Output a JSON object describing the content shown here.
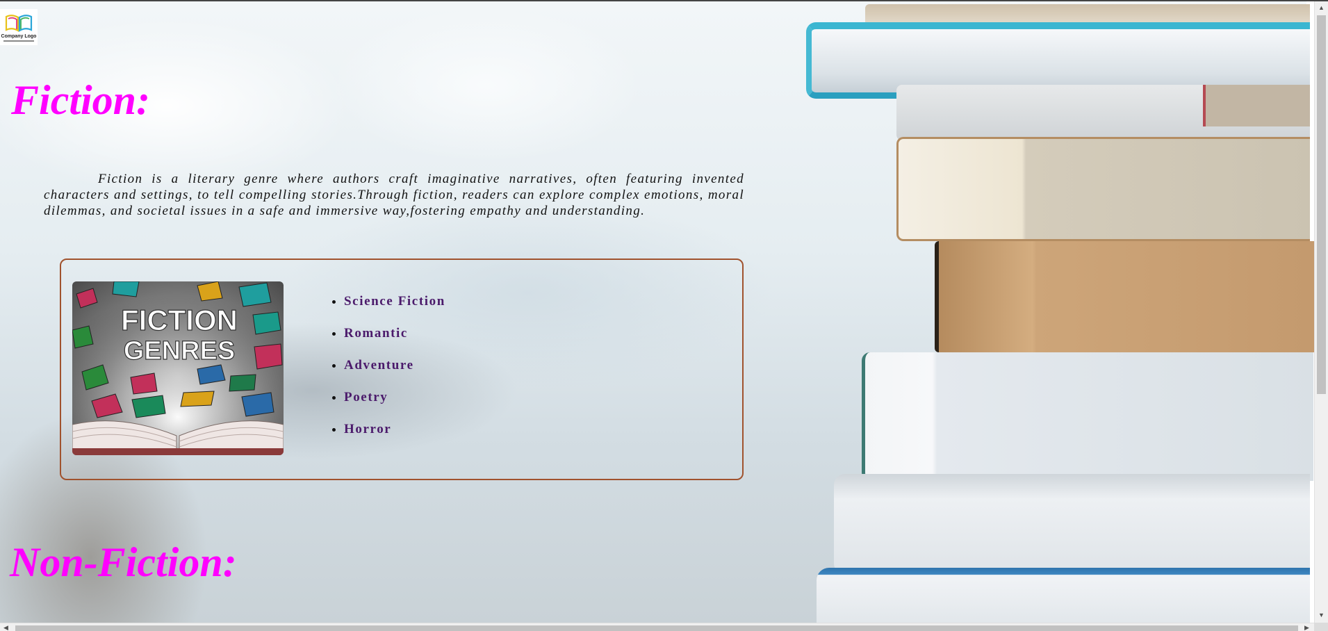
{
  "logo": {
    "text": "Company Logo",
    "icon": "open-book-logo-icon"
  },
  "fiction": {
    "heading": "Fiction:",
    "description": "Fiction is a literary genre where authors craft imaginative narratives, often featuring invented characters and settings, to tell compelling stories.Through fiction, readers can explore complex emotions, moral dilemmas, and societal issues in a safe and immersive way,fostering empathy and understanding.",
    "image": {
      "title_line1": "FICTION",
      "title_line2": "GENRES"
    },
    "genres": [
      "Science Fiction",
      "Romantic",
      "Adventure",
      "Poetry",
      "Horror"
    ]
  },
  "nonfiction": {
    "heading": "Non-Fiction:"
  },
  "colors": {
    "heading": "#ff00ff",
    "genre_text": "#4b1a6b",
    "card_border": "#a0522d"
  }
}
